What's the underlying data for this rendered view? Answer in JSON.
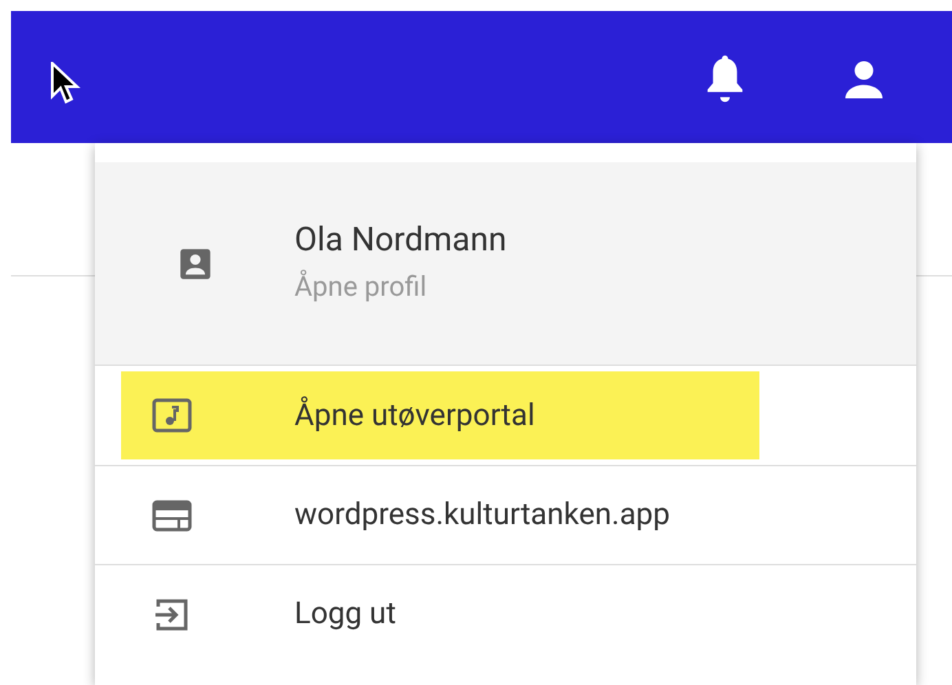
{
  "profile": {
    "name": "Ola Nordmann",
    "subtitle": "Åpne profil"
  },
  "menu_items": [
    {
      "label": "Åpne utøverportal",
      "kind": "music",
      "highlighted": true
    },
    {
      "label": "wordpress.kulturtanken.app",
      "kind": "web",
      "highlighted": false
    },
    {
      "label": "Logg ut",
      "kind": "logout",
      "highlighted": false
    }
  ]
}
